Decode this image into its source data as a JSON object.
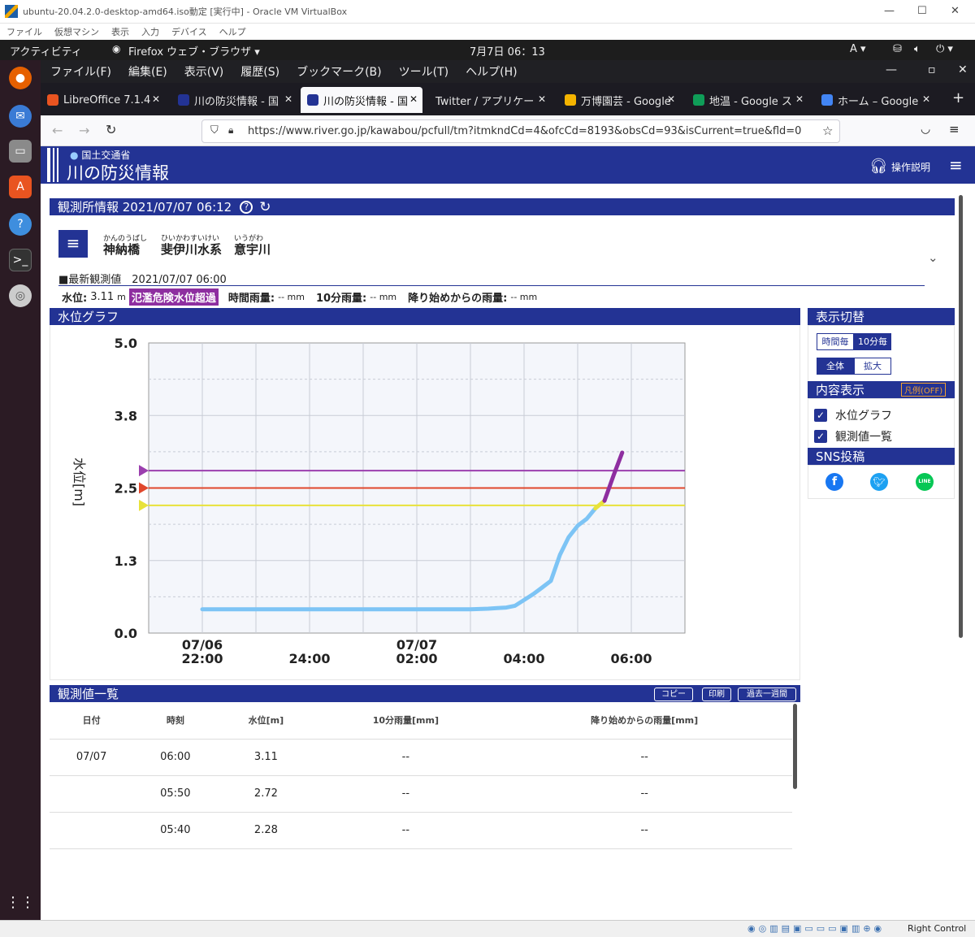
{
  "vbox": {
    "title": "ubuntu-20.04.2.0-desktop-amd64.iso動定 [実行中] - Oracle VM VirtualBox",
    "menu": [
      "ファイル",
      "仮想マシン",
      "表示",
      "入力",
      "デバイス",
      "ヘルプ"
    ],
    "status_right": "Right Control"
  },
  "ubuntu": {
    "activities": "アクティビティ",
    "app_menu": "Firefox ウェブ・ブラウザ ▾",
    "clock": "7月7日 06：13",
    "input": "A ▾"
  },
  "firefox": {
    "menu": [
      "ファイル(F)",
      "編集(E)",
      "表示(V)",
      "履歴(S)",
      "ブックマーク(B)",
      "ツール(T)",
      "ヘルプ(H)"
    ],
    "tabs": [
      {
        "label": "LibreOffice 7.1.4",
        "color": "#e95420"
      },
      {
        "label": "川の防災情報 - 国",
        "color": "#233394"
      },
      {
        "label": "川の防災情報 - 国",
        "color": "#233394"
      },
      {
        "label": "Twitter / アプリケー",
        "color": "#1c1b22"
      },
      {
        "label": "万博園芸 - Google",
        "color": "#f4b400"
      },
      {
        "label": "地温 - Google ス",
        "color": "#0f9d58"
      },
      {
        "label": "ホーム – Google",
        "color": "#4285f4"
      }
    ],
    "url": "https://www.river.go.jp/kawabou/pcfull/tm?itmkndCd=4&ofcCd=8193&obsCd=93&isCurrent=true&fld=0"
  },
  "site": {
    "ministry": "国土交通省",
    "name": "川の防災情報",
    "help": "操作説明"
  },
  "station": {
    "header": "観測所情報 2021/07/07 06:12",
    "name_ruby": "かんのうばし",
    "name": "神納橋",
    "system_ruby": "ひいかわすいけい",
    "system": "斐伊川水系",
    "river_ruby": "いうがわ",
    "river": "意宇川",
    "latest": "■最新観測値　2021/07/07 06:00",
    "level_label": "水位:",
    "level_value": "3.11",
    "level_unit": "m",
    "alert": "氾濫危険水位超過",
    "hourly_label": "時間雨量:",
    "hourly_value": "-- mm",
    "tenmin_label": "10分雨量:",
    "tenmin_value": "-- mm",
    "total_label": "降り始めからの雨量:",
    "total_value": "-- mm"
  },
  "graph_panel": {
    "title": "水位グラフ"
  },
  "chart_data": {
    "type": "line",
    "ylabel": "水位[m]",
    "ylim": [
      0,
      5
    ],
    "yticks": [
      "5.0",
      "3.8",
      "2.5",
      "1.3",
      "0.0"
    ],
    "xticks": [
      {
        "l1": "07/06",
        "l2": "22:00"
      },
      {
        "l1": "",
        "l2": "24:00"
      },
      {
        "l1": "07/07",
        "l2": "02:00"
      },
      {
        "l1": "",
        "l2": "04:00"
      },
      {
        "l1": "",
        "l2": "06:00"
      }
    ],
    "x_hours": [
      -2,
      -1.5,
      -1,
      -0.5,
      0,
      0.5,
      1,
      1.5,
      2,
      2.5,
      3,
      3.33,
      3.5,
      3.67,
      3.83,
      4,
      4.17,
      4.33,
      4.5,
      4.67,
      4.83,
      5,
      5.17,
      5.33,
      5.5,
      5.67,
      5.83,
      6
    ],
    "values": [
      0.41,
      0.41,
      0.41,
      0.41,
      0.41,
      0.41,
      0.41,
      0.41,
      0.41,
      0.41,
      0.41,
      0.42,
      0.43,
      0.44,
      0.47,
      0.57,
      0.67,
      0.78,
      0.9,
      1.35,
      1.65,
      1.85,
      1.97,
      2.15,
      2.28,
      2.72,
      3.11,
      3.11
    ],
    "segments": [
      {
        "from": 0,
        "to": 23,
        "color": "#7dc4f5"
      },
      {
        "from": 23,
        "to": 24,
        "color": "#e8e23a"
      },
      {
        "from": 24,
        "to": 26,
        "color": "#8e2ea0"
      }
    ],
    "thresholds": [
      {
        "value": 2.8,
        "color": "#9b3fae"
      },
      {
        "value": 2.5,
        "color": "#e0472c"
      },
      {
        "value": 2.2,
        "color": "#e8e23a"
      }
    ]
  },
  "side": {
    "display_title": "表示切替",
    "hourly": "時間毎",
    "tenmin": "10分毎",
    "all": "全体",
    "zoom": "拡大",
    "content_title": "内容表示",
    "legend": "凡例(OFF)",
    "opt_graph": "水位グラフ",
    "opt_list": "観測値一覧",
    "sns_title": "SNS投稿"
  },
  "table": {
    "title": "観測値一覧",
    "buttons": [
      "コピー",
      "印刷",
      "過去一週間"
    ],
    "headers": [
      "日付",
      "時刻",
      "水位[m]",
      "10分雨量[mm]",
      "降り始めからの雨量[mm]"
    ],
    "rows": [
      [
        "07/07",
        "06:00",
        "3.11",
        "--",
        "--"
      ],
      [
        "",
        "05:50",
        "2.72",
        "--",
        "--"
      ],
      [
        "",
        "05:40",
        "2.28",
        "--",
        "--"
      ]
    ]
  }
}
